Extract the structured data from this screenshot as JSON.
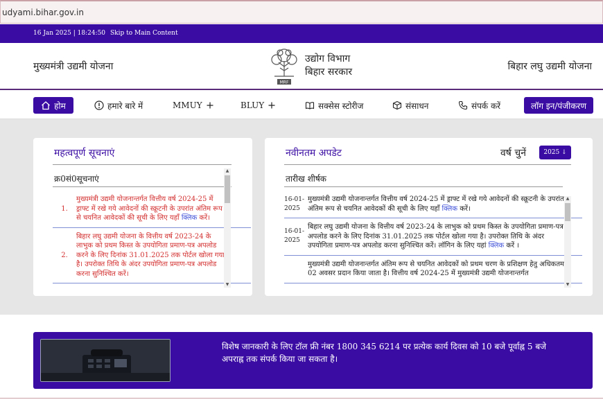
{
  "browser": {
    "url": "udyami.bihar.gov.in"
  },
  "topbar": {
    "datetime": "16 Jan 2025 | 18:24:50",
    "skip_link": "Skip to Main Content"
  },
  "header": {
    "left_title": "मुख्यमंत्री उद्यमी योजना",
    "dept_line1": "उद्योग विभाग",
    "dept_line2": "बिहार सरकार",
    "logo_text": "MRF",
    "right_title": "बिहार लघु उद्यमी योजना"
  },
  "nav": {
    "home": "होम",
    "about": "हमारे बारे में",
    "mmuy": "MMUY",
    "bluy": "BLUY",
    "stories": "सक्सेस स्टोरीज",
    "resources": "संसाधन",
    "contact": "संपर्क करें",
    "login": "लॉग इन/पंजीकरण",
    "icons": [
      "home-icon",
      "info-icon",
      "plus-icon",
      "book-icon",
      "box-icon",
      "phone-icon"
    ]
  },
  "notices": {
    "title": "महत्वपूर्ण सूचनाएं",
    "header": "क्र0सं0सूचनाएं",
    "items": [
      {
        "num": "1.",
        "text": "मुख्यमंत्री उद्यमी योजनान्तर्गत वित्तीय वर्ष 2024-25 में ड्राफ्ट में रखे गये आवेदनों की स्क्रूटनी के उपरांत अंतिम रूप से चयनित आवेदकों की सूची के लिए यहाँ",
        "link": "क्लिक",
        "after": "करें।"
      },
      {
        "num": "2.",
        "text": "बिहार लघु उद्यमी योजना के वित्तीय वर्ष 2023-24 के लाभुक को प्रथम किस्त के उपयोगिता प्रमाण-पत्र अपलोड करने के लिए दिनांक 31.01.2025 तक पोर्टल खोला गया है। उपरोक्त तिथि के अंदर उपयोगिता प्रमाण-पत्र अपलोड करना सुनिश्चित करें।",
        "link": "",
        "after": ""
      }
    ]
  },
  "updates": {
    "title": "नवीनतम अपडेट",
    "year_label": "वर्ष चुनें",
    "year_value": "2025 ↓",
    "header": "तारीख शीर्षक",
    "items": [
      {
        "date": "16-01-2025",
        "text": "मुख्यमंत्री उद्यमी योजनान्तर्गत वित्तीय वर्ष 2024-25 में ड्राफ्ट में रखे गये आवेदनों की स्क्रूटनी के उपरांत अंतिम रूप से चयनित आवेदकों की सूची के लिए यहाँ",
        "link": "क्लिक",
        "after": "करें।"
      },
      {
        "date": "16-01-2025",
        "text": "बिहार लघु उद्यमी योजना के वित्तीय वर्ष 2023-24 के लाभुक को प्रथम किस्त के उपयोगिता प्रमाण-पत्र अपलोड करने के लिए दिनांक 31.01.2025 तक पोर्टल खोला गया है। उपरोक्त तिथि के अंदर उपयोगिता प्रमाण-पत्र अपलोड करना सुनिश्चित करें। लॉगिन के लिए यहां",
        "link": "क्लिक",
        "after": "करें ।"
      },
      {
        "date": "",
        "text": "मुख्यमंत्री उद्यमी योजनान्तर्गत अंतिम रूप से चयनित आवेदकों को प्रथम चरण के प्रशिक्षण हेतु अधिकतम 02 अवसर प्रदान किया जाता है। वित्तीय वर्ष 2024-25 में मुख्यमंत्री उद्यमी योजनान्तर्गत",
        "link": "",
        "after": ""
      }
    ]
  },
  "banner": {
    "message": "विशेष जानकारी के लिए टॉल फ्री नंबर 1800 345 6214 पर प्रत्येक कार्य दिवस को 10 बजे पूर्वाह्न 5 बजे अपराह्न तक संपर्क किया जा सकता है।"
  },
  "colors": {
    "primary": "#3a0ca3",
    "notice_red": "#d32f2f",
    "link_blue": "#3f51d8",
    "divider": "#7f8fd6"
  }
}
